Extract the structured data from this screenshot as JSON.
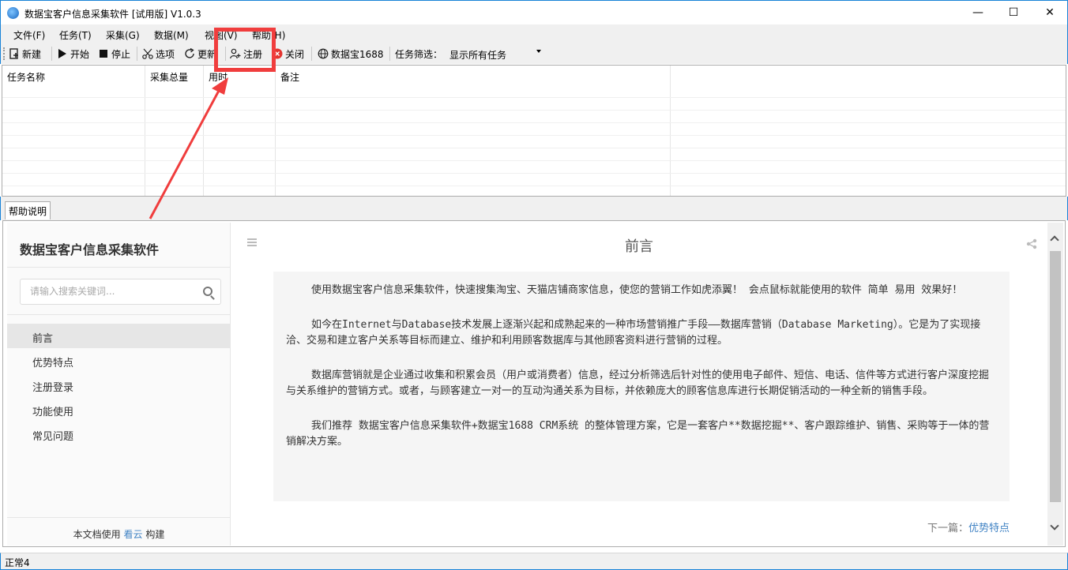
{
  "window": {
    "title": "数据宝客户信息采集软件 [试用版] V1.0.3",
    "minimize": "—",
    "maximize": "☐",
    "close": "✕"
  },
  "menu": [
    "文件(F)",
    "任务(T)",
    "采集(G)",
    "数据(M)",
    "视图(V)",
    "帮助(H)"
  ],
  "toolbar": {
    "new": "新建",
    "start": "开始",
    "stop": "停止",
    "options": "选项",
    "update": "更新",
    "register": "注册",
    "close": "关闭",
    "site": "数据宝1688",
    "filter_label": "任务筛选：",
    "filter_value": "显示所有任务"
  },
  "tasklist": {
    "columns": [
      "任务名称",
      "采集总量",
      "用时",
      "备注"
    ]
  },
  "help_tab": "帮助说明",
  "sidebar": {
    "title": "数据宝客户信息采集软件",
    "search_placeholder": "请输入搜索关键词...",
    "items": [
      "前言",
      "优势特点",
      "注册登录",
      "功能使用",
      "常见问题"
    ],
    "footer_prefix": "本文档使用",
    "footer_link": "看云",
    "footer_suffix": "构建"
  },
  "content": {
    "title": "前言",
    "paragraphs": [
      "使用数据宝客户信息采集软件，快速搜集淘宝、天猫店铺商家信息，使您的营销工作如虎添翼！ 会点鼠标就能使用的软件 简单 易用 效果好！",
      "如今在Internet与Database技术发展上逐渐兴起和成熟起来的一种市场营销推广手段——数据库营销（Database Marketing）。它是为了实现接洽、交易和建立客户关系等目标而建立、维护和利用顾客数据库与其他顾客资料进行营销的过程。",
      "数据库营销就是企业通过收集和积累会员（用户或消费者）信息，经过分析筛选后针对性的使用电子邮件、短信、电话、信件等方式进行客户深度挖掘与关系维护的营销方式。或者，与顾客建立一对一的互动沟通关系为目标，并依赖庞大的顾客信息库进行长期促销活动的一种全新的销售手段。",
      "我们推荐 数据宝客户信息采集软件+数据宝1688 CRM系统 的整体管理方案，它是一套客户**数据挖掘**、客户跟踪维护、销售、采购等于一体的营销解决方案。"
    ],
    "next_prefix": "下一篇：",
    "next_link": "优势特点"
  },
  "status": "正常4",
  "colors": {
    "accent": "#1883d7",
    "annotation": "#f03d3d",
    "link": "#4183c4"
  }
}
